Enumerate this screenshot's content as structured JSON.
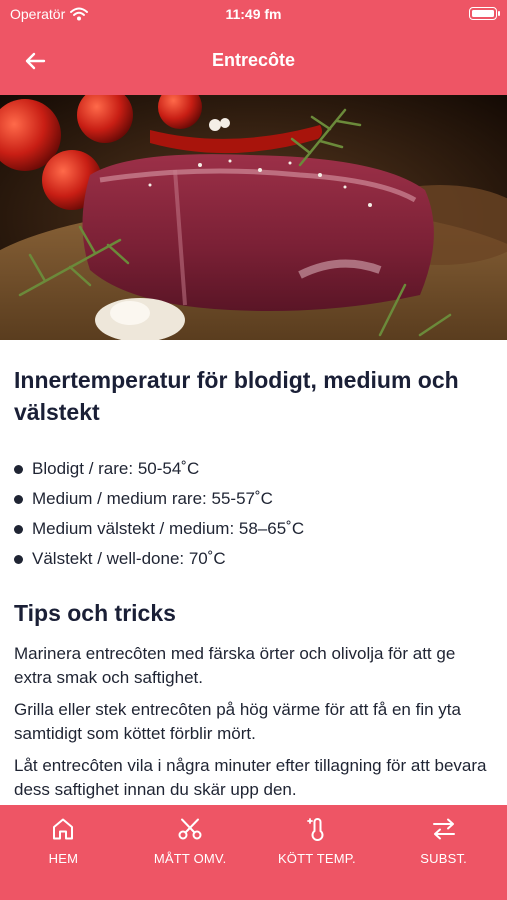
{
  "status_bar": {
    "carrier": "Operatör",
    "time": "11:49 fm"
  },
  "nav": {
    "title": "Entrecôte",
    "back_icon": "arrow-left-icon"
  },
  "hero": {
    "image": "raw beef steak on wooden board with tomatoes, rosemary and chili"
  },
  "content": {
    "heading": "Innertemperatur för blodigt, medium och välstekt",
    "temperatures": [
      {
        "label": "Blodigt / rare: 50-54˚C"
      },
      {
        "label": "Medium / medium rare: 55-57˚C"
      },
      {
        "label": "Medium välstekt / medium:  58–65˚C"
      },
      {
        "label": "Välstekt / well-done:  70˚C"
      }
    ],
    "tips_heading": "Tips och tricks",
    "tips": [
      "Marinera entrecôten med färska örter och olivolja för att ge extra smak och saftighet.",
      "Grilla eller stek entrecôten på hög värme för att få en fin yta samtidigt som köttet förblir mört.",
      "Låt entrecôten vila i några minuter efter tillagning för att bevara dess saftighet innan du skär upp den."
    ]
  },
  "tabbar": {
    "tabs": [
      {
        "label": "HEM",
        "icon": "home-icon"
      },
      {
        "label": "MÅTT OMV.",
        "icon": "scissors-icon"
      },
      {
        "label": "KÖTT TEMP.",
        "icon": "thermometer-icon"
      },
      {
        "label": "SUBST.",
        "icon": "swap-arrows-icon"
      }
    ]
  },
  "colors": {
    "accent": "#ee5565",
    "text": "#1a1f36",
    "background": "#ffffff"
  }
}
